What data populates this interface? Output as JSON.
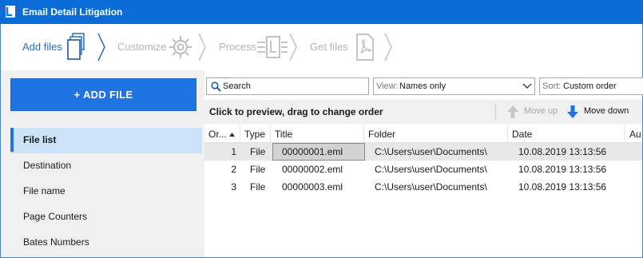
{
  "window": {
    "title": "Email Detail Litigation"
  },
  "steps": [
    {
      "label": "Add files",
      "state": "active",
      "icon": "files-icon"
    },
    {
      "label": "Customize",
      "state": "inactive",
      "icon": "gear-icon"
    },
    {
      "label": "Process",
      "state": "inactive",
      "icon": "process-icon"
    },
    {
      "label": "Get files",
      "state": "inactive",
      "icon": "pdf-icon"
    }
  ],
  "sidebar": {
    "add_button": "+ ADD FILE",
    "items": [
      {
        "label": "File list",
        "active": true
      },
      {
        "label": "Destination",
        "active": false
      },
      {
        "label": "File name",
        "active": false
      },
      {
        "label": "Page Counters",
        "active": false
      },
      {
        "label": "Bates Numbers",
        "active": false
      }
    ]
  },
  "search": {
    "placeholder": "Search",
    "value": ""
  },
  "view": {
    "label": "View:",
    "value": "Names only"
  },
  "sort": {
    "label": "Sort:",
    "value": "Custom order"
  },
  "toolbar": {
    "hint": "Click to preview, drag to change order",
    "move_up": "Move up",
    "move_down": "Move down"
  },
  "table": {
    "columns": [
      "Or...",
      "Type",
      "Title",
      "Folder",
      "Date",
      "Au"
    ],
    "rows": [
      {
        "order": "1",
        "type": "File",
        "title": "00000001.eml",
        "folder": "C:\\Users\\user\\Documents\\",
        "date": "10.08.2019 13:13:56"
      },
      {
        "order": "2",
        "type": "File",
        "title": "00000002.eml",
        "folder": "C:\\Users\\user\\Documents\\",
        "date": "10.08.2019 13:13:56"
      },
      {
        "order": "3",
        "type": "File",
        "title": "00000003.eml",
        "folder": "C:\\Users\\user\\Documents\\",
        "date": "10.08.2019 13:13:56"
      }
    ]
  },
  "colors": {
    "titlebar": "#0a6cd6",
    "accent": "#1e74e3",
    "active_step": "#2f6bb5",
    "inactive_step": "#b3b3b3",
    "nav_active_bg": "#cce3f7"
  }
}
